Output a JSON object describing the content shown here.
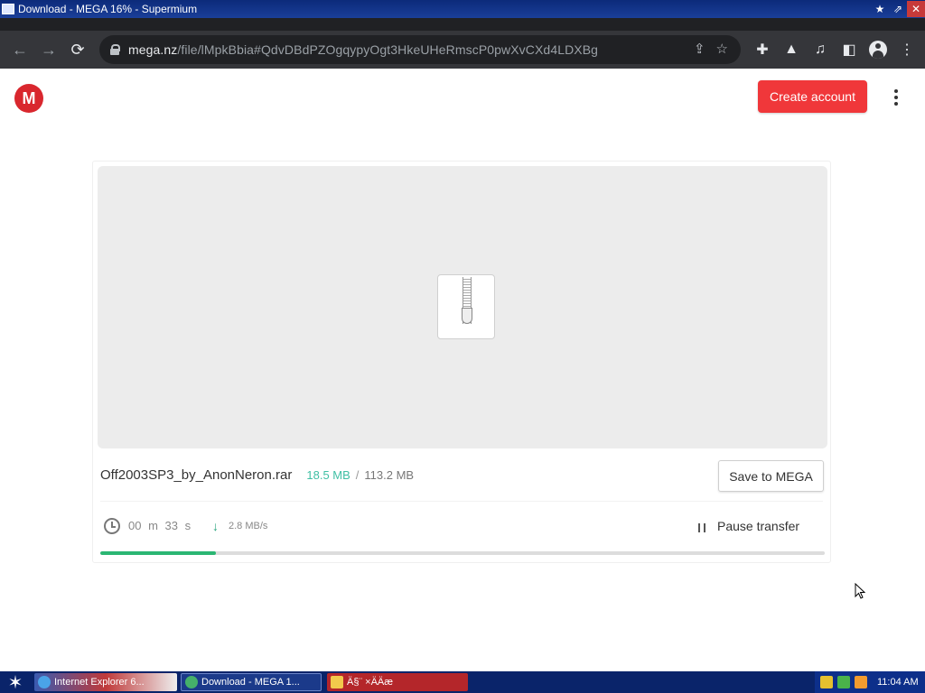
{
  "window": {
    "title": "Download - MEGA 16% - Supermium",
    "controls": [
      "pin-icon",
      "restore-icon",
      "close-icon"
    ]
  },
  "browser": {
    "url_domain": "mega.nz",
    "url_path": "/file/lMpkBbia#QdvDBdPZOgqypyOgt3HkeUHeRmscP0pwXvCXd4LDXBg",
    "nav_icons": [
      "back-icon",
      "forward-icon",
      "reload-icon"
    ],
    "omnibox_icons": [
      "share-icon",
      "star-icon"
    ],
    "toolbar_icons": [
      "extensions-icon",
      "labs-icon",
      "media-icon",
      "sidepanel-icon",
      "profile-icon",
      "menu-icon"
    ]
  },
  "header": {
    "logo_letter": "M",
    "create_account": "Create account"
  },
  "download": {
    "file_name": "Off2003SP3_by_AnonNeron.rar",
    "size_done": "18.5 MB",
    "size_sep": "/",
    "size_total": "113.2 MB",
    "save_label": "Save to MEGA",
    "time_remaining": "00 m  33 s",
    "speed": "2.8 MB/s",
    "pause_label": "Pause transfer",
    "progress_percent": 16
  },
  "taskbar": {
    "tasks": [
      {
        "label": "Internet Explorer 6..."
      },
      {
        "label": "Download - MEGA 1..."
      },
      {
        "label": "Ä§¨ ×ÄÄæ"
      }
    ],
    "clock": "11:04 AM"
  },
  "colors": {
    "mega_red": "#d9272e",
    "create_button": "#f0373a",
    "progress": "#2bb673",
    "size_done": "#3fbfa4"
  }
}
